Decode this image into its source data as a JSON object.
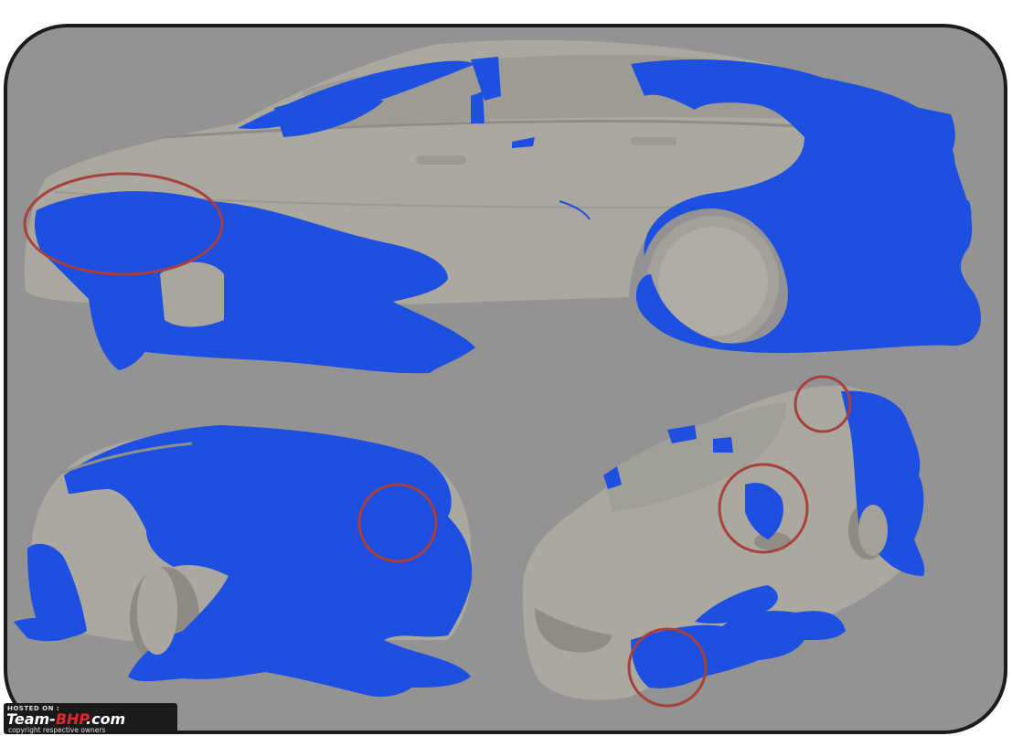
{
  "image": {
    "description_colors": {
      "frame_background": "#939393",
      "car_body": "#a9a7a0",
      "car_shadow": "#7d7b76",
      "flow_overlay": "#1d4fe0",
      "flow_overlay_dark": "#0b2fb8",
      "highlight_circle": "#a8403e"
    }
  },
  "watermark": {
    "hosted_on": "HOSTED ON :",
    "brand_main": "Team-",
    "brand_accent": "BHP",
    "brand_suffix": ".com",
    "copyright": "copyright respective owners"
  }
}
